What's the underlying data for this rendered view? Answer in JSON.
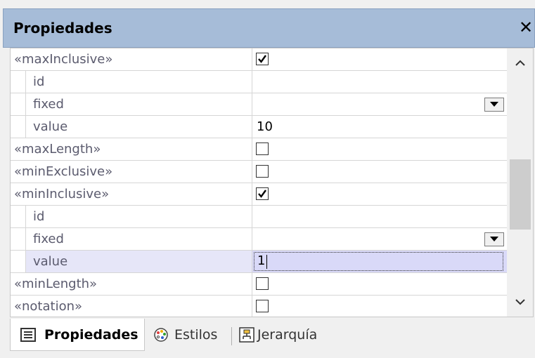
{
  "panel": {
    "title": "Propiedades",
    "close_glyph": "✕"
  },
  "rows": [
    {
      "name": "«maxInclusive»",
      "level": 0,
      "type": "checkbox",
      "checked": true
    },
    {
      "name": "id",
      "level": 1,
      "type": "text",
      "value": ""
    },
    {
      "name": "fixed",
      "level": 1,
      "type": "dropdown",
      "value": ""
    },
    {
      "name": "value",
      "level": 1,
      "type": "text",
      "value": "10"
    },
    {
      "name": "«maxLength»",
      "level": 0,
      "type": "checkbox",
      "checked": false
    },
    {
      "name": "«minExclusive»",
      "level": 0,
      "type": "checkbox",
      "checked": false
    },
    {
      "name": "«minInclusive»",
      "level": 0,
      "type": "checkbox",
      "checked": true
    },
    {
      "name": "id",
      "level": 1,
      "type": "text",
      "value": ""
    },
    {
      "name": "fixed",
      "level": 1,
      "type": "dropdown",
      "value": ""
    },
    {
      "name": "value",
      "level": 1,
      "type": "edit",
      "value": "1",
      "selected": true
    },
    {
      "name": "«minLength»",
      "level": 0,
      "type": "checkbox",
      "checked": false
    },
    {
      "name": "«notation»",
      "level": 0,
      "type": "checkbox",
      "checked": false
    }
  ],
  "tabs": [
    {
      "label": "Propiedades",
      "icon": "properties-icon",
      "active": true
    },
    {
      "label": "Estilos",
      "icon": "palette-icon",
      "active": false
    },
    {
      "label": "Jerarquía",
      "icon": "hierarchy-icon",
      "active": false
    }
  ]
}
